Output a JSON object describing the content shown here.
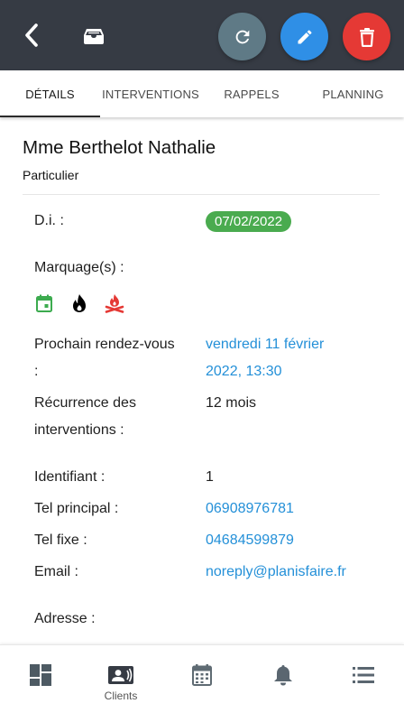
{
  "colors": {
    "topbar": "#363b44",
    "refresh_button": "#5f7a86",
    "edit_button": "#2f8fe6",
    "delete_button": "#e53935",
    "badge_green": "#4aab4f",
    "link_blue": "#2490d8",
    "marking_calendar": "#3cab4f",
    "marking_fire": "#000000",
    "marking_campfire": "#e53935"
  },
  "header": {
    "icons": [
      "back-arrow-icon",
      "archive-tray-icon",
      "refresh-icon",
      "pencil-icon",
      "trash-icon"
    ]
  },
  "tabs": [
    {
      "label": "DÉTAILS",
      "active": true
    },
    {
      "label": "INTERVENTIONS",
      "active": false
    },
    {
      "label": "RAPPELS",
      "active": false
    },
    {
      "label": "PLANNING",
      "active": false
    }
  ],
  "client": {
    "name": "Mme Berthelot Nathalie",
    "type": "Particulier"
  },
  "details": {
    "di_label": "D.i. :",
    "di_value": "07/02/2022",
    "markings_label": "Marquage(s) :",
    "markings": [
      "calendar-icon",
      "fire-icon",
      "campfire-icon"
    ],
    "next_appointment_label_1": "Prochain rendez-vous",
    "next_appointment_label_2": ":",
    "next_appointment_value_1": "vendredi 11 février",
    "next_appointment_value_2": "2022, 13:30",
    "recurrence_label_1": "Récurrence des",
    "recurrence_label_2": "interventions :",
    "recurrence_value": "12 mois",
    "id_label": "Identifiant :",
    "id_value": "1",
    "main_phone_label": "Tel principal :",
    "main_phone_value": "06908976781",
    "landline_label": "Tel fixe :",
    "landline_value": "04684599879",
    "email_label": "Email :",
    "email_value": "noreply@planisfaire.fr",
    "address_label": "Adresse :"
  },
  "bottom_nav": [
    {
      "icon": "dashboard-icon",
      "label": "",
      "active": false
    },
    {
      "icon": "contacts-icon",
      "label": "Clients",
      "active": true
    },
    {
      "icon": "calendar-grid-icon",
      "label": "",
      "active": false
    },
    {
      "icon": "bell-icon",
      "label": "",
      "active": false
    },
    {
      "icon": "list-icon",
      "label": "",
      "active": false
    }
  ]
}
